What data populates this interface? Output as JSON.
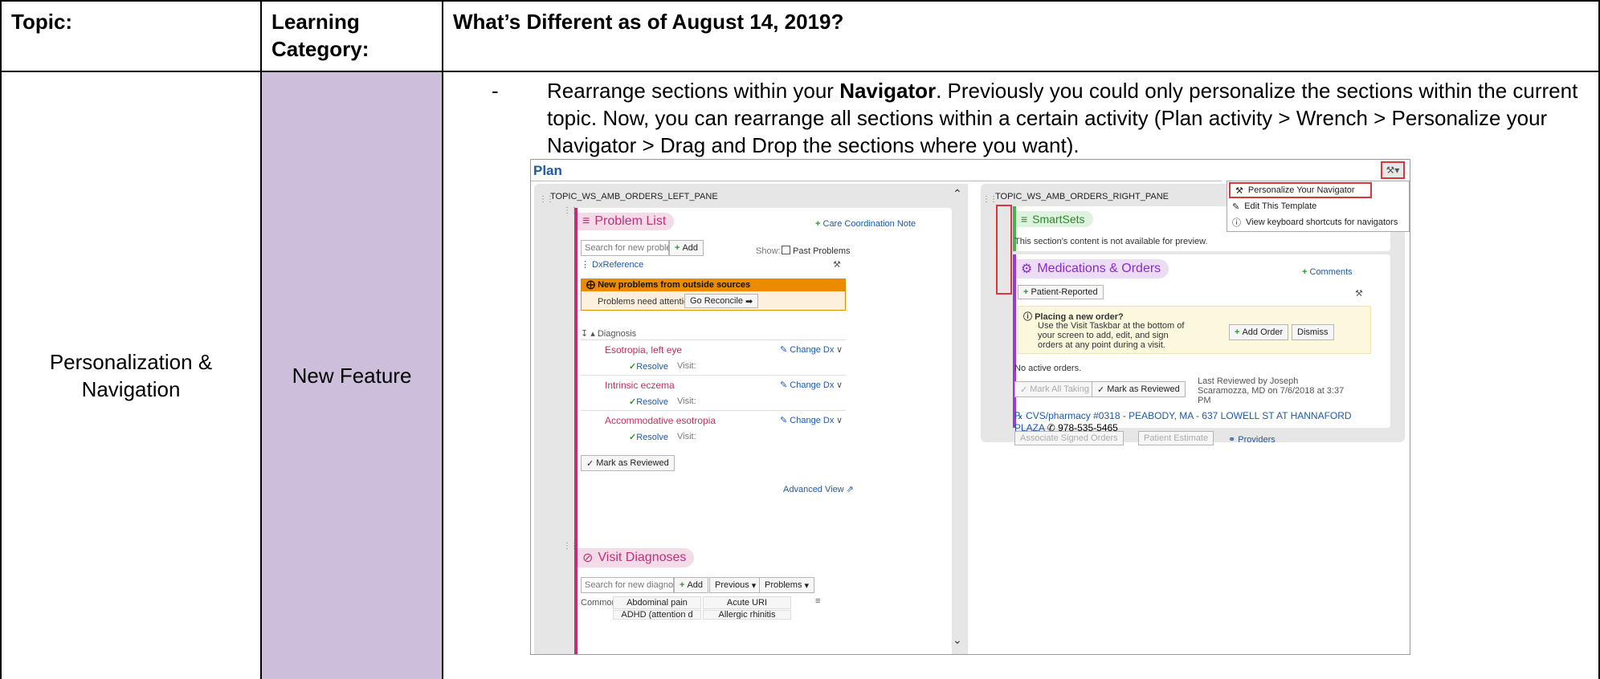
{
  "header": {
    "topic_label": "Topic:",
    "category_label": "Learning Category:",
    "whats_different": "What’s Different as of August 14, 2019?"
  },
  "row": {
    "topic": "Personalization & Navigation",
    "category": "New Feature",
    "bullet": "-",
    "desc_pre": "Rearrange sections within your ",
    "desc_bold": "Navigator",
    "desc_post": ". Previously you could only personalize the sections within the current topic. Now, you can rearrange all sections within a certain activity (Plan activity > Wrench > Personalize your Navigator > Drag and Drop the sections where you want)."
  },
  "shot": {
    "plan": "Plan",
    "menu": [
      "Personalize Your Navigator",
      "Edit This Template",
      "View keyboard shortcuts for navigators"
    ],
    "left_pane": "TOPIC_WS_AMB_ORDERS_LEFT_PANE",
    "right_pane": "TOPIC_WS_AMB_ORDERS_RIGHT_PANE",
    "problem_list": "Problem List",
    "care_note": "Care Coordination Note",
    "search_problem": "Search for new problem",
    "add": "Add",
    "show": "Show:",
    "past_problems": "Past Problems",
    "dxref": "DxReference",
    "outside_title": "New problems from outside sources",
    "outside_msg": "Problems need attention.",
    "go_reconcile": "Go Reconcile",
    "diagnosis": "Diagnosis",
    "problems": [
      {
        "name": "Esotropia, left eye",
        "change": "Change Dx",
        "resolve": "Resolve",
        "visit": "Visit:"
      },
      {
        "name": "Intrinsic eczema",
        "change": "Change Dx",
        "resolve": "Resolve",
        "visit": "Visit:"
      },
      {
        "name": "Accommodative esotropia",
        "change": "Change Dx",
        "resolve": "Resolve",
        "visit": "Visit:"
      }
    ],
    "mark_reviewed": "Mark as Reviewed",
    "advanced_view": "Advanced View",
    "visit_dx": "Visit Diagnoses",
    "search_dx": "Search for new diagnosis",
    "previous": "Previous",
    "problems_btn": "Problems",
    "common": "Common",
    "dx_col1": [
      "Abdominal pain",
      "ADHD (attention d"
    ],
    "dx_col2": [
      "Acute URI",
      "Allergic rhinitis"
    ],
    "smartsets": "SmartSets",
    "not_available": "This section's content is not available for preview.",
    "meds_orders": "Medications & Orders",
    "comments": "Comments",
    "patient_reported": "Patient-Reported",
    "placing_title": "Placing a new order?",
    "placing_msg": "Use the Visit Taskbar at the bottom of your screen to add, edit, and sign orders at any point during a visit.",
    "add_order": "Add Order",
    "dismiss": "Dismiss",
    "no_active": "No active orders.",
    "mark_all_taking": "Mark All Taking",
    "mark_as_reviewed": "Mark as Reviewed",
    "last_reviewed": "Last Reviewed by Joseph Scaramozza, MD on 7/6/2018 at 3:37 PM",
    "pharmacy": "CVS/pharmacy #0318 - PEABODY, MA - 637 LOWELL ST AT HANNAFORD PLAZA",
    "phone": "978-535-5465",
    "associate": "Associate Signed Orders",
    "patient_estimate": "Patient Estimate",
    "providers": "Providers"
  }
}
